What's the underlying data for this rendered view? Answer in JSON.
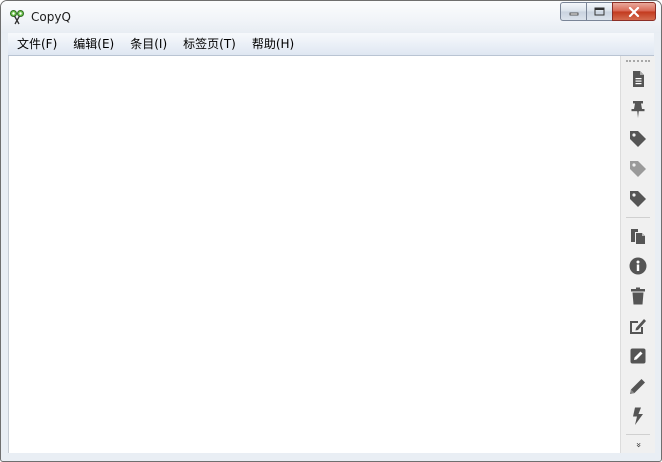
{
  "window": {
    "title": "CopyQ",
    "app_icon": "copyq-scissors-icon"
  },
  "caption": {
    "minimize_icon": "minimize-icon",
    "maximize_icon": "maximize-icon",
    "close_icon": "close-icon"
  },
  "menu": [
    {
      "label": "文件(F)"
    },
    {
      "label": "编辑(E)"
    },
    {
      "label": "条目(I)"
    },
    {
      "label": "标签页(T)"
    },
    {
      "label": "帮助(H)"
    }
  ],
  "toolbar": {
    "items": [
      {
        "icon": "new-document-icon"
      },
      {
        "icon": "pin-icon"
      },
      {
        "icon": "tag-icon"
      },
      {
        "icon": "tag-icon-light"
      },
      {
        "icon": "tag-icon-alt"
      },
      {
        "icon": "copy-icon"
      },
      {
        "icon": "info-icon"
      },
      {
        "icon": "trash-icon"
      },
      {
        "icon": "edit-external-icon"
      },
      {
        "icon": "edit-square-icon"
      },
      {
        "icon": "pencil-icon"
      },
      {
        "icon": "lightning-icon"
      }
    ],
    "more_icon": "chevron-double-down-icon",
    "more_glyph": "»",
    "icon_color": "#555555",
    "icon_color_light": "#9a9a9a"
  }
}
